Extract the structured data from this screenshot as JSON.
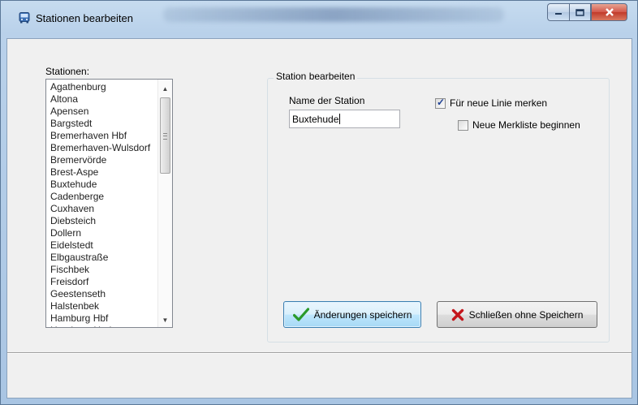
{
  "window": {
    "title": "Stationen bearbeiten",
    "icon": "bus-icon"
  },
  "stations": {
    "label": "Stationen:",
    "items": [
      "Agathenburg",
      "Altona",
      "Apensen",
      "Bargstedt",
      "Bremerhaven Hbf",
      "Bremerhaven-Wulsdorf",
      "Bremervörde",
      "Brest-Aspe",
      "Buxtehude",
      "Cadenberge",
      "Cuxhaven",
      "Diebsteich",
      "Dollern",
      "Eidelstedt",
      "Elbgaustraße",
      "Fischbek",
      "Freisdorf",
      "Geestenseth",
      "Halstenbek",
      "Hamburg Hbf",
      "Hamburg-Harburg"
    ]
  },
  "edit": {
    "group_title": "Station bearbeiten",
    "name_label": "Name der Station",
    "name_value": "Buxtehude",
    "remember_label": "Für neue Linie merken",
    "remember_checked": true,
    "new_list_label": "Neue Merkliste beginnen",
    "new_list_checked": false
  },
  "buttons": {
    "save_label": "Änderungen speichern",
    "close_label": "Schließen ohne Speichern"
  },
  "colors": {
    "save_check": "#2a9a2a",
    "close_x": "#c4161c"
  }
}
